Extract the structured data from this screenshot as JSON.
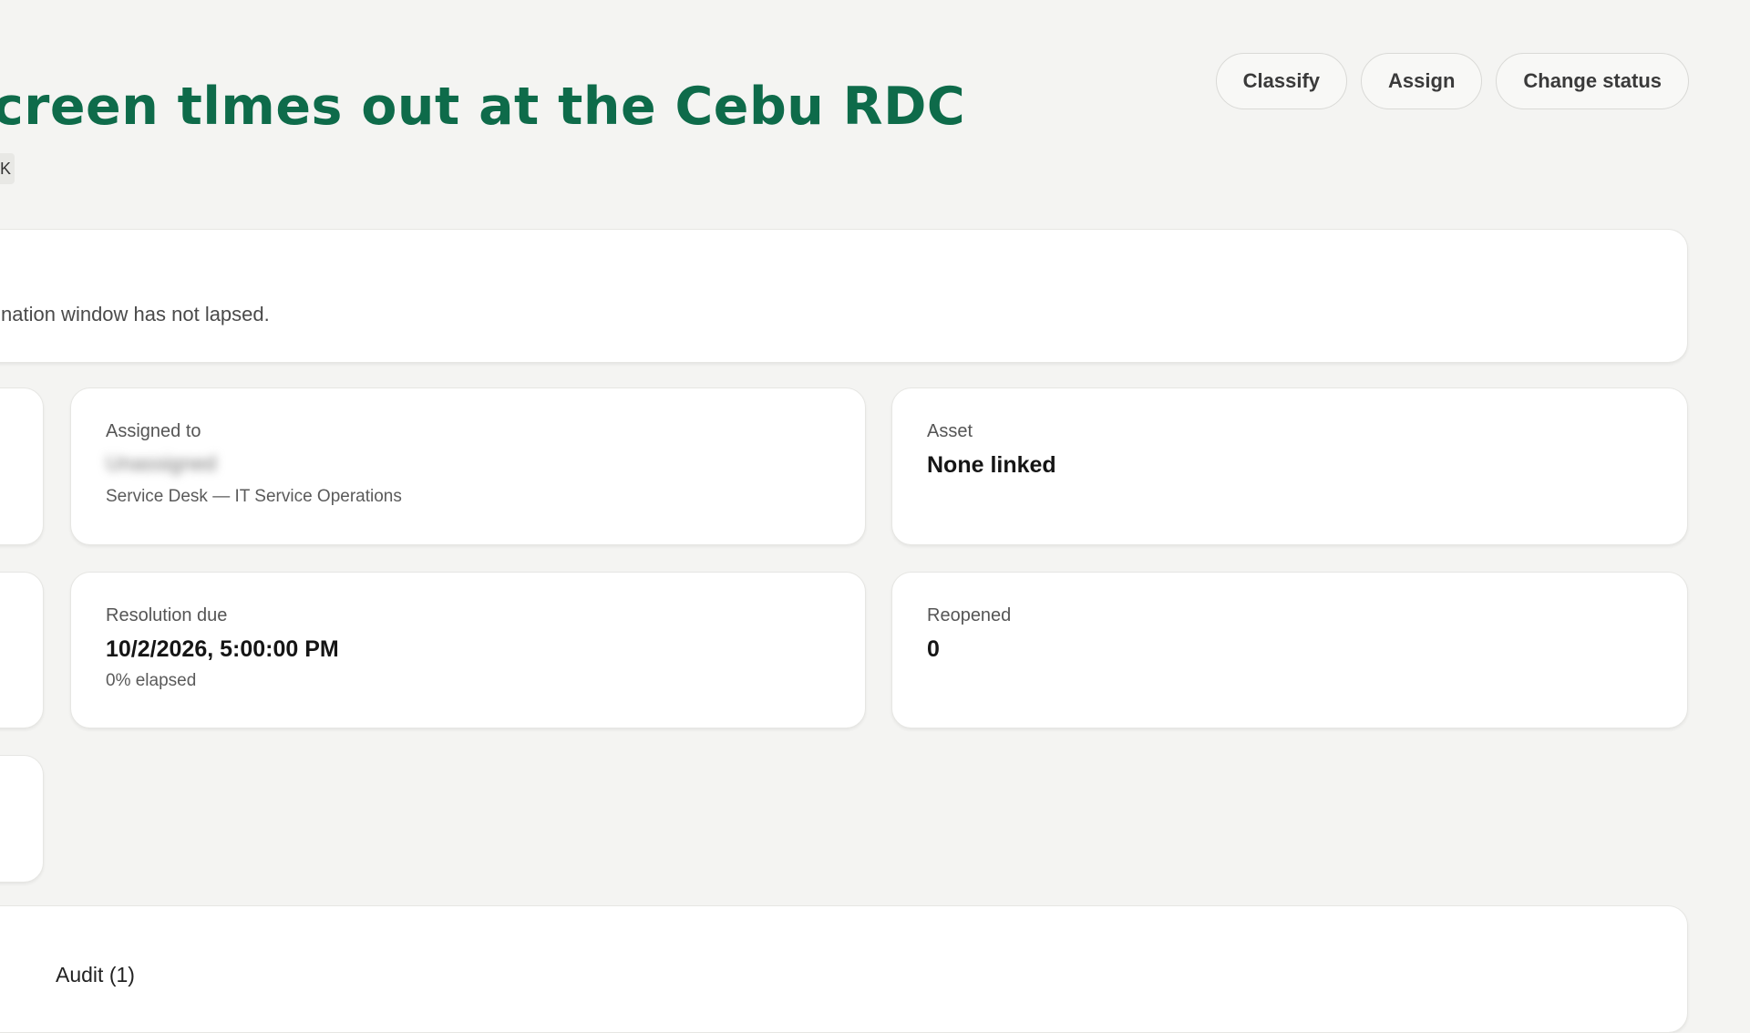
{
  "header": {
    "title": "creen tlmes out at the Cebu RDC",
    "subtag": "K"
  },
  "actions": {
    "classify": "Classify",
    "assign": "Assign",
    "change_status": "Change status"
  },
  "banner": {
    "text": "nation window has not lapsed."
  },
  "cards": {
    "assigned": {
      "label": "Assigned to",
      "name": "Unassigned",
      "team": "Service Desk — IT Service Operations"
    },
    "asset": {
      "label": "Asset",
      "value": "None linked"
    },
    "resolution": {
      "label": "Resolution due",
      "value": "10/2/2026, 5:00:00 PM",
      "elapsed": "0% elapsed"
    },
    "reopened": {
      "label": "Reopened",
      "value": "0"
    }
  },
  "tabs": {
    "partial": ")",
    "audit": "Audit (1)"
  }
}
